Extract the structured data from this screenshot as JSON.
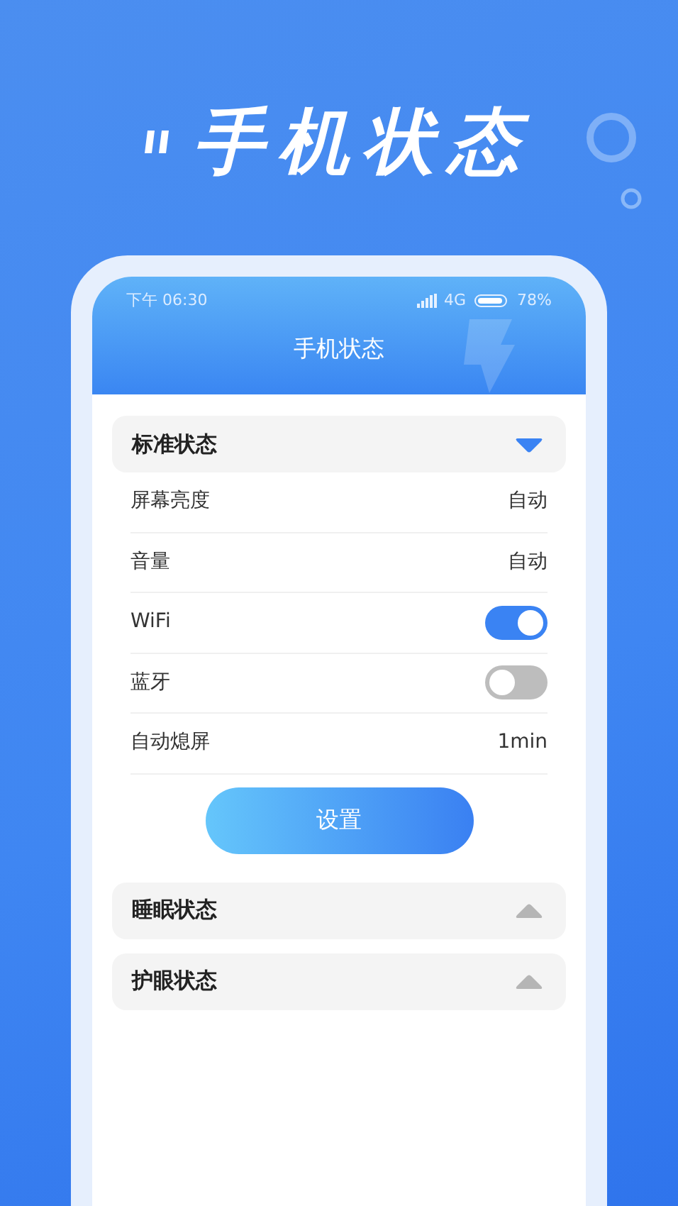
{
  "headline": "手机状态",
  "status_bar": {
    "time": "下午 06:30",
    "network": "4G",
    "battery": "78%"
  },
  "screen_title": "手机状态",
  "sections": [
    {
      "title": "标准状态",
      "expanded": true,
      "rows": [
        {
          "kind": "value",
          "label": "屏幕亮度",
          "value": "自动"
        },
        {
          "kind": "value",
          "label": "音量",
          "value": "自动"
        },
        {
          "kind": "toggle",
          "label": "WiFi",
          "on": true
        },
        {
          "kind": "toggle",
          "label": "蓝牙",
          "on": false
        },
        {
          "kind": "value",
          "label": "自动熄屏",
          "value": "1min"
        }
      ],
      "button": "设置"
    },
    {
      "title": "睡眠状态",
      "expanded": false
    },
    {
      "title": "护眼状态",
      "expanded": false
    }
  ]
}
